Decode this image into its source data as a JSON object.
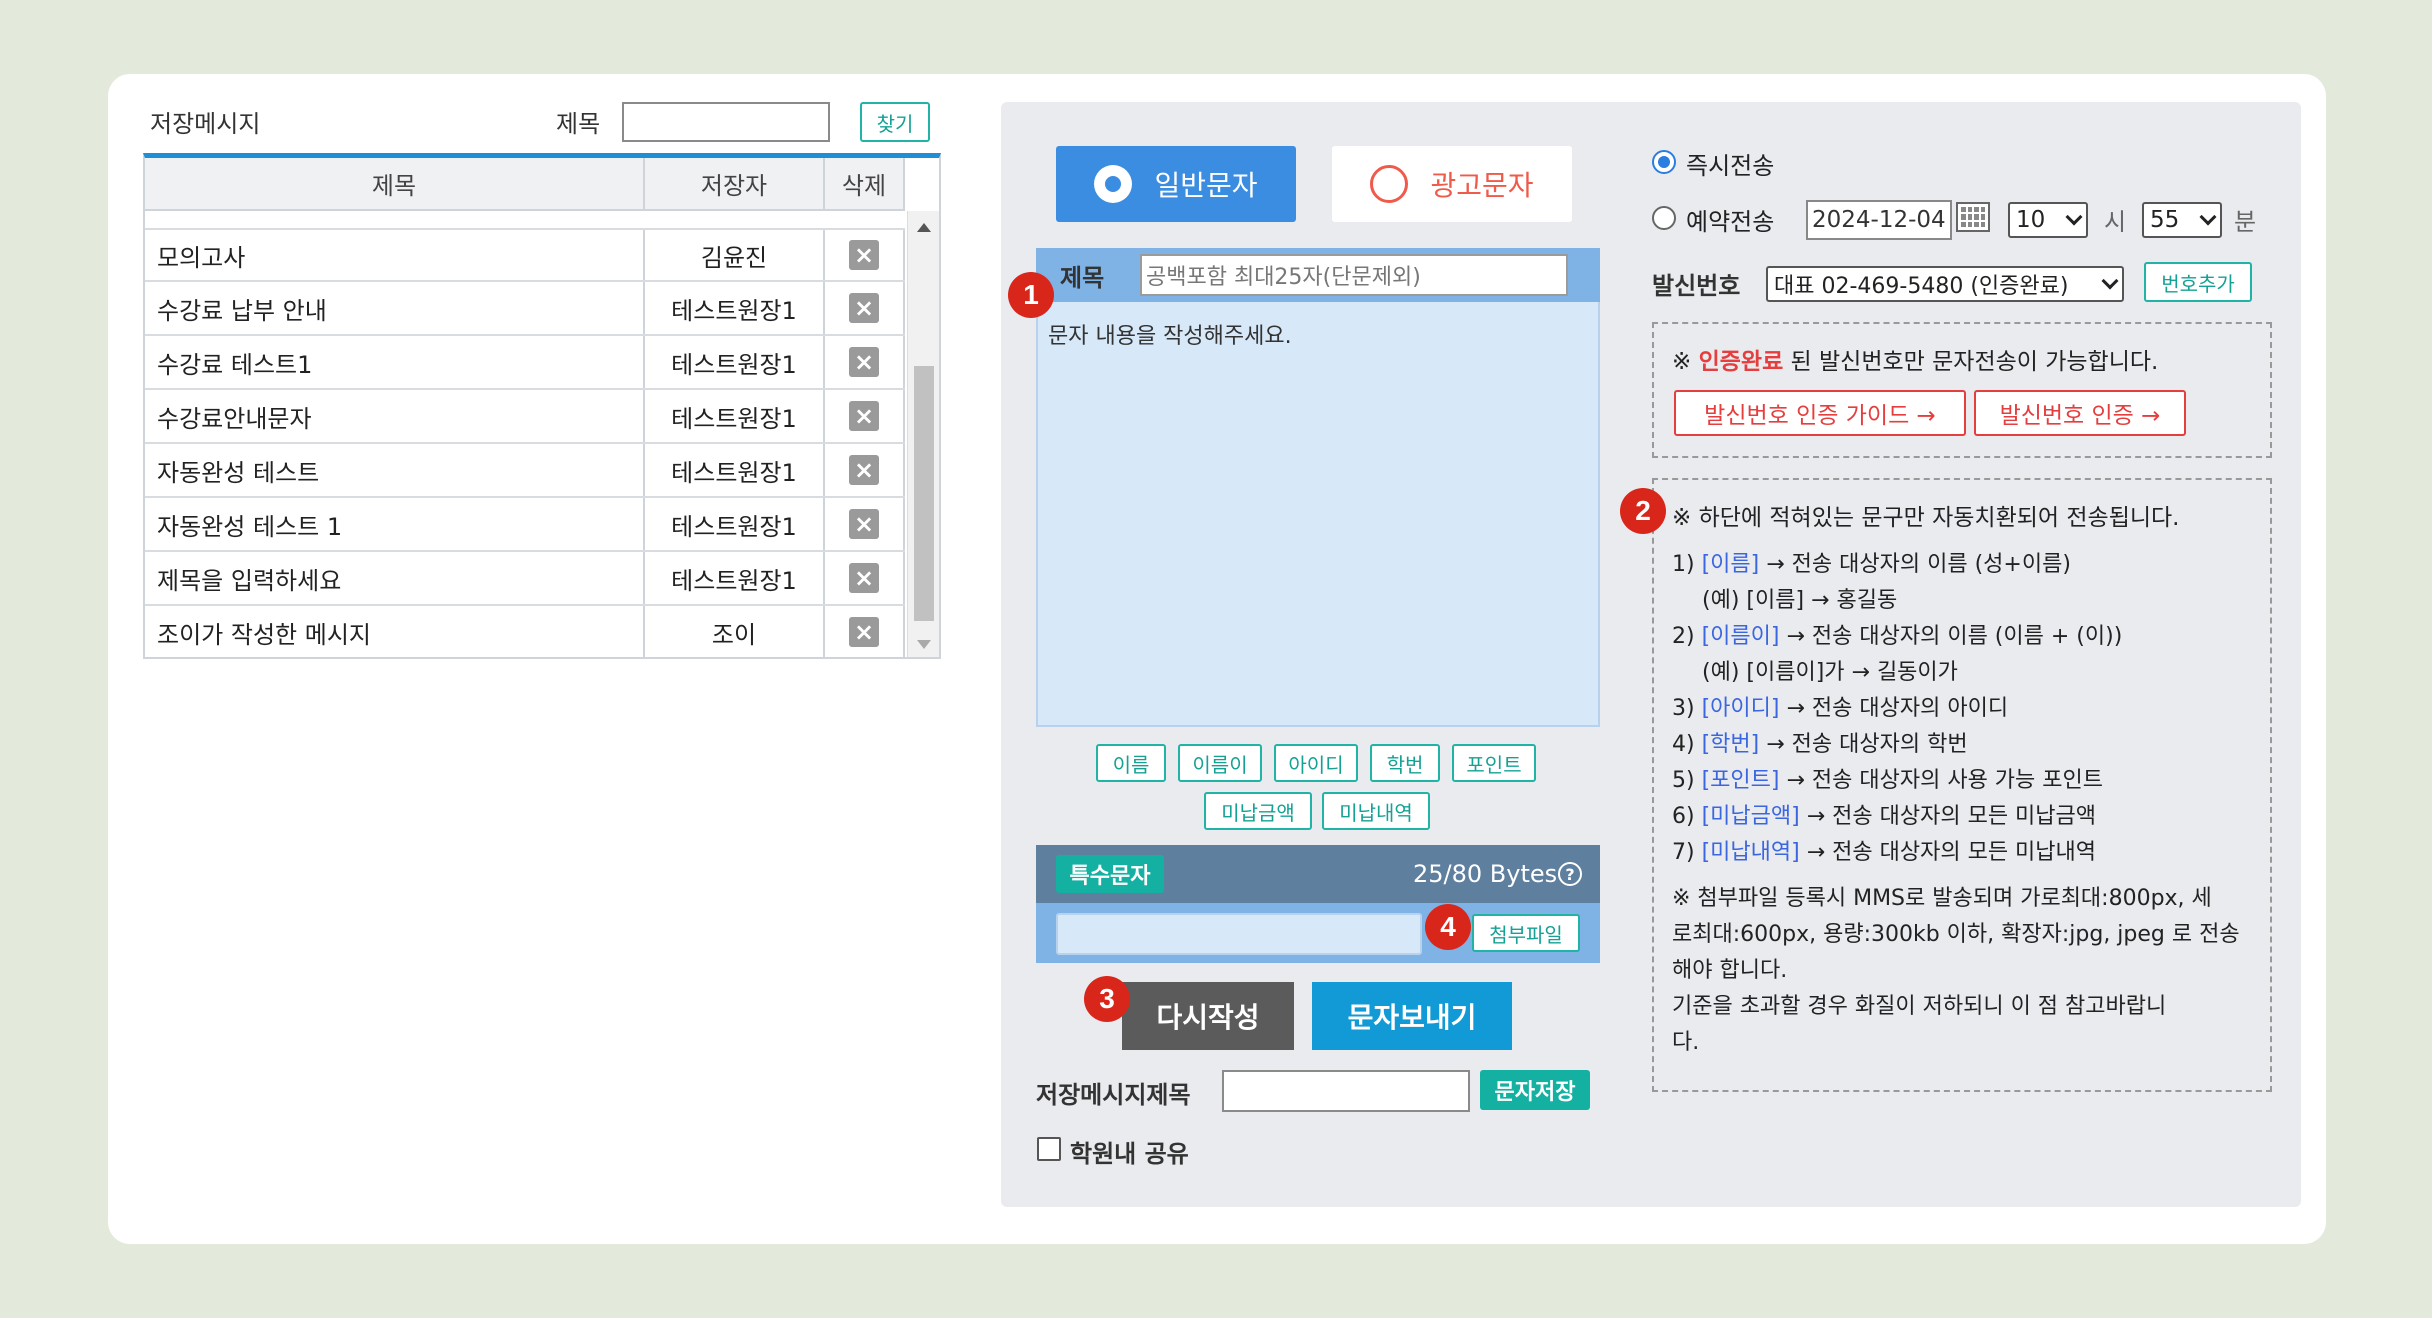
{
  "saved": {
    "title": "저장메시지",
    "search_label": "제목",
    "search_value": "",
    "search_button": "찾기",
    "columns": [
      "제목",
      "저장자",
      "삭제"
    ],
    "rows": [
      {
        "title": "모의고사",
        "author": "김윤진"
      },
      {
        "title": "수강료 납부 안내",
        "author": "테스트원장1"
      },
      {
        "title": "수강료 테스트1",
        "author": "테스트원장1"
      },
      {
        "title": "수강료안내문자",
        "author": "테스트원장1"
      },
      {
        "title": "자동완성 테스트",
        "author": "테스트원장1"
      },
      {
        "title": "자동완성 테스트 1",
        "author": "테스트원장1"
      },
      {
        "title": "제목을 입력하세요",
        "author": "테스트원장1"
      },
      {
        "title": "조이가 작성한 메시지",
        "author": "조이"
      }
    ]
  },
  "compose": {
    "type_normal": "일반문자",
    "type_ad": "광고문자",
    "subject_label": "제목",
    "subject_placeholder": "공백포함 최대25자(단문제외)",
    "body_placeholder": "문자 내용을 작성해주세요.",
    "tags_row1": [
      "이름",
      "이름이",
      "아이디",
      "학번",
      "포인트"
    ],
    "tags_row2": [
      "미납금액",
      "미납내역"
    ],
    "special_chars": "특수문자",
    "bytes": "25/80 Bytes",
    "help_icon": "?",
    "attach_button": "첨부파일",
    "reset_button": "다시작성",
    "send_button": "문자보내기",
    "save_title_label": "저장메시지제목",
    "save_button": "문자저장",
    "share_label": "학원내 공유"
  },
  "badges": [
    "1",
    "2",
    "3",
    "4"
  ],
  "schedule": {
    "immediate": "즉시전송",
    "reserved": "예약전송",
    "date": "2024-12-04",
    "hour": "10",
    "hour_unit": "시",
    "minute": "55",
    "minute_unit": "분",
    "sender_label": "발신번호",
    "sender_value": "대표 02-469-5480 (인증완료)",
    "add_number": "번호추가"
  },
  "verify": {
    "note_prefix": "※ ",
    "note_red": "인증완료",
    "note_rest": " 된 발신번호만 문자전송이 가능합니다.",
    "guide_button": "발신번호 인증 가이드 →",
    "verify_button": "발신번호 인증 →"
  },
  "info": {
    "heading": "※ 하단에 적혀있는 문구만 자동치환되어 전송됩니다.",
    "items": [
      {
        "num": "1)",
        "tag": "[이름]",
        "desc": "→ 전송 대상자의 이름 (성+이름)"
      },
      {
        "num": "",
        "tag": "",
        "desc": "(예) [이름] → 홍길동"
      },
      {
        "num": "2)",
        "tag": "[이름이]",
        "desc": "→ 전송 대상자의 이름 (이름 + (이))"
      },
      {
        "num": "",
        "tag": "",
        "desc": "(예) [이름이]가 → 길동이가"
      },
      {
        "num": "3)",
        "tag": "[아이디]",
        "desc": "→ 전송 대상자의 아이디"
      },
      {
        "num": "4)",
        "tag": "[학번]",
        "desc": "→ 전송 대상자의 학번"
      },
      {
        "num": "5)",
        "tag": "[포인트]",
        "desc": "→ 전송 대상자의 사용 가능 포인트"
      },
      {
        "num": "6)",
        "tag": "[미납금액]",
        "desc": "→ 전송 대상자의 모든 미납금액"
      },
      {
        "num": "7)",
        "tag": "[미납내역]",
        "desc": "→ 전송 대상자의 모든 미납내역"
      }
    ],
    "attach_note": [
      "※ 첨부파일 등록시 MMS로 발송되며 가로최대:800px, 세",
      "로최대:600px, 용량:300kb 이하, 확장자:jpg, jpeg 로 전송",
      "해야 합니다.",
      "기준을 초과할 경우 화질이 저하되니 이 점 참고바랍니",
      "다."
    ]
  },
  "colors": {
    "accent": "#3a8de0",
    "teal": "#14b1a3",
    "badge": "#d9261b",
    "ad": "#ef5a4a"
  }
}
